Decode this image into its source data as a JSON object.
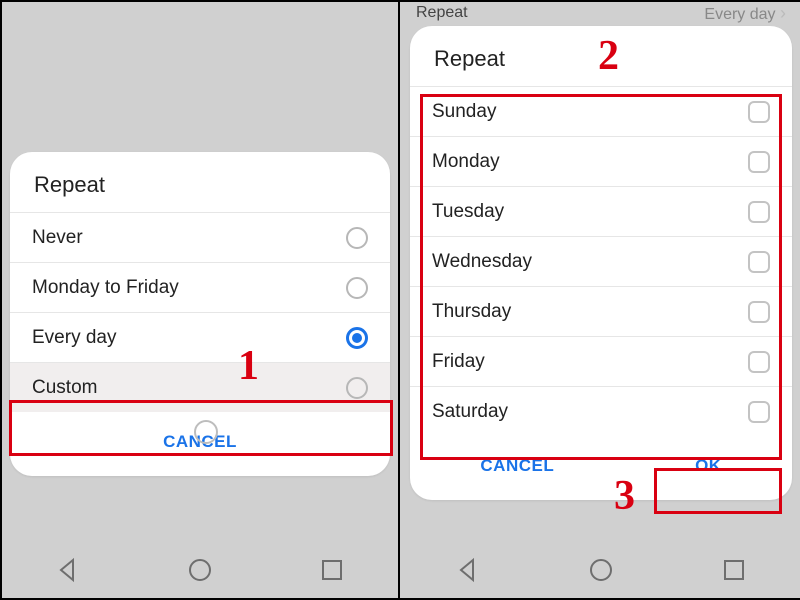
{
  "left": {
    "title": "Repeat",
    "options": [
      {
        "label": "Never",
        "selected": false
      },
      {
        "label": "Monday to Friday",
        "selected": false
      },
      {
        "label": "Every day",
        "selected": true
      },
      {
        "label": "Custom",
        "selected": false
      }
    ],
    "cancel": "CANCEL"
  },
  "right": {
    "header_label": "Repeat",
    "header_value": "Every day",
    "title": "Repeat",
    "days": [
      {
        "label": "Sunday",
        "checked": false
      },
      {
        "label": "Monday",
        "checked": false
      },
      {
        "label": "Tuesday",
        "checked": false
      },
      {
        "label": "Wednesday",
        "checked": false
      },
      {
        "label": "Thursday",
        "checked": false
      },
      {
        "label": "Friday",
        "checked": false
      },
      {
        "label": "Saturday",
        "checked": false
      }
    ],
    "cancel": "CANCEL",
    "ok": "OK"
  },
  "annotations": {
    "n1": "1",
    "n2": "2",
    "n3": "3"
  }
}
